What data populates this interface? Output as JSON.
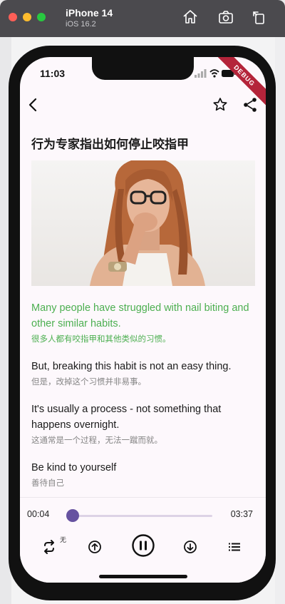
{
  "window": {
    "device_name": "iPhone 14",
    "os_version": "iOS 16.2",
    "debug_banner": "DEBUG"
  },
  "status_bar": {
    "time": "11:03"
  },
  "article": {
    "title": "行为专家指出如何停止咬指甲",
    "paragraphs": [
      {
        "en": "Many people have struggled with nail biting and other similar habits.",
        "zh": "很多人都有咬指甲和其他类似的习惯。",
        "active": true
      },
      {
        "en": "But, breaking this habit is not an easy thing.",
        "zh": "但是，改掉这个习惯并非易事。",
        "active": false
      },
      {
        "en": "It's usually a process - not something that happens overnight.",
        "zh": "这通常是一个过程，无法一蹴而就。",
        "active": false
      },
      {
        "en": "Be kind to yourself",
        "zh": "善待自己",
        "active": false
      }
    ]
  },
  "player": {
    "current_time": "00:04",
    "total_time": "03:37",
    "progress": 0.02,
    "loop_mode_label": "无"
  },
  "colors": {
    "accent": "#6652a0",
    "highlight_text": "#4caf50",
    "debug": "#b4243a"
  },
  "icons": {
    "back": "chevron-left-icon",
    "favorite": "star-outline-icon",
    "share": "share-icon",
    "loop": "repeat-icon",
    "prev": "arrow-up-circle-icon",
    "pause": "pause-circle-icon",
    "next": "arrow-down-circle-icon",
    "playlist": "list-icon"
  }
}
